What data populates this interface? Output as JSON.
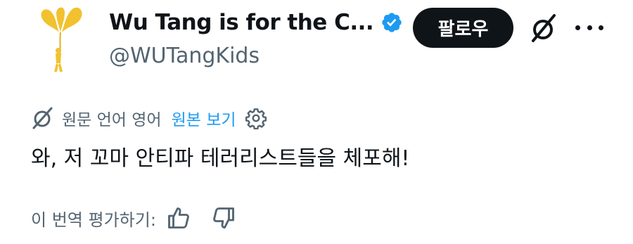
{
  "profile": {
    "display_name": "Wu Tang is for the C...",
    "handle": "@WUTangKids",
    "verified": true,
    "follow_label": "팔로우",
    "avatar_icon": "balloon-flower-icon",
    "verified_icon": "verified-badge-icon",
    "grok_icon": "grok-icon",
    "more_icon": "more-options-icon"
  },
  "translation": {
    "translated_label": "원문 언어 영어",
    "show_original_label": "원본 보기",
    "translate_icon": "grok-translate-icon",
    "settings_icon": "settings-gear-icon"
  },
  "tweet": {
    "text": "와, 저 꼬마 안티파 테러리스트들을 체포해!"
  },
  "rating": {
    "label": "이 번역 평가하기:",
    "thumbs_up_icon": "thumbs-up-icon",
    "thumbs_down_icon": "thumbs-down-icon"
  },
  "colors": {
    "text_primary": "#0f1419",
    "text_secondary": "#536471",
    "link": "#1d9bf0",
    "verified_badge": "#1d9bf0",
    "follow_button_bg": "#0f1419",
    "follow_button_text": "#ffffff"
  }
}
